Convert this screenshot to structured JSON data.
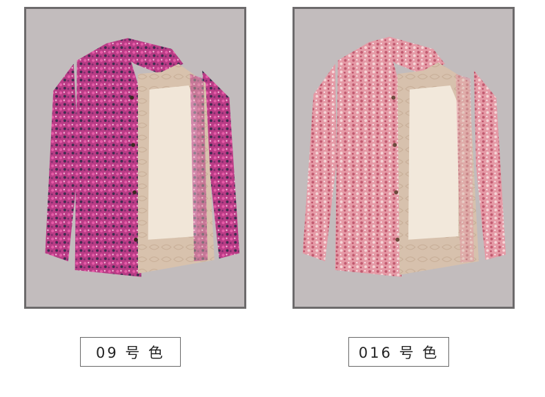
{
  "products": [
    {
      "id": "left",
      "label": "09 号 色",
      "shell_color": "#b93c86",
      "shell_accent": "#e75aa8",
      "shell_dark": "#3e2d4f",
      "lining_color": "#d8c2ad",
      "fleece_color": "#f1e6d8"
    },
    {
      "id": "right",
      "label": "016 号 色",
      "shell_color": "#e59aa6",
      "shell_accent": "#c25a70",
      "shell_dark": "#f5d7d8",
      "lining_color": "#d7c1ad",
      "fleece_color": "#f2e8db"
    }
  ],
  "colors": {
    "panel_bg": "#c2bcbd",
    "panel_border": "#6c6a6b"
  }
}
